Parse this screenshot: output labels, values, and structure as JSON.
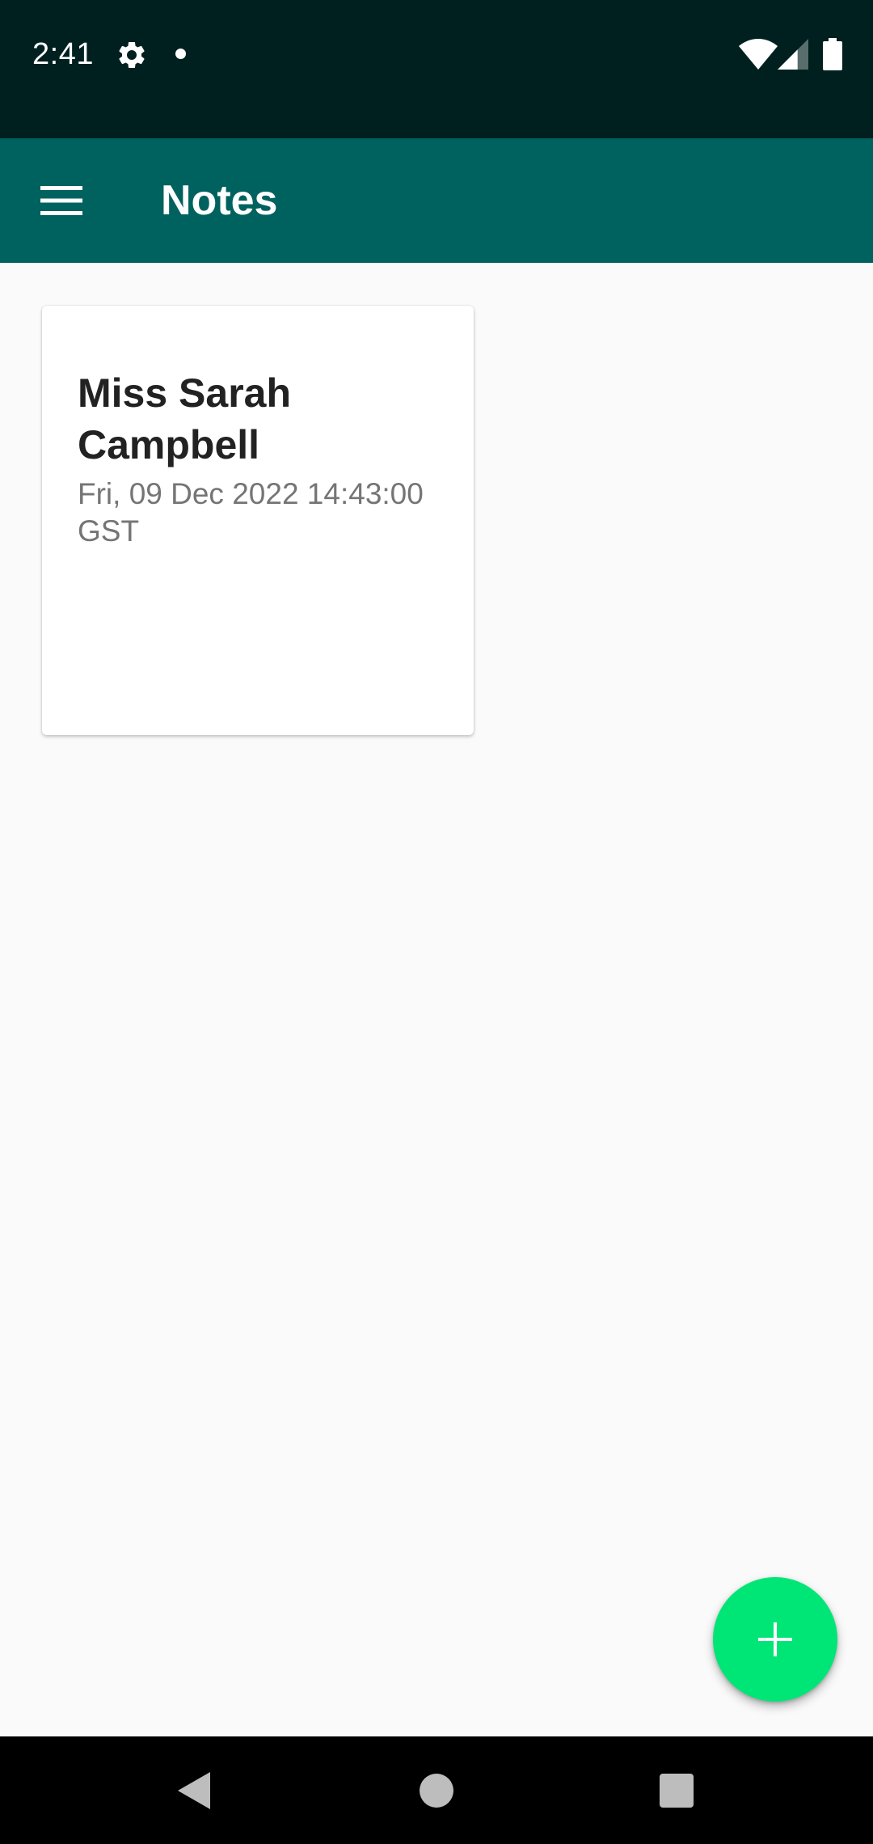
{
  "status_bar": {
    "time": "2:41",
    "icons": [
      "gear-icon",
      "dot-icon",
      "wifi-icon",
      "signal-icon",
      "battery-icon"
    ]
  },
  "app_bar": {
    "title": "Notes",
    "menu_icon": "hamburger-menu-icon",
    "background_color": "#00625f"
  },
  "notes": [
    {
      "title": "Miss Sarah Campbell",
      "date": "Fri, 09 Dec 2022 14:43:00 GST"
    }
  ],
  "fab": {
    "icon": "plus-icon",
    "color": "#00e676"
  },
  "nav_bar": {
    "buttons": [
      "back-icon",
      "home-icon",
      "recents-icon"
    ]
  }
}
